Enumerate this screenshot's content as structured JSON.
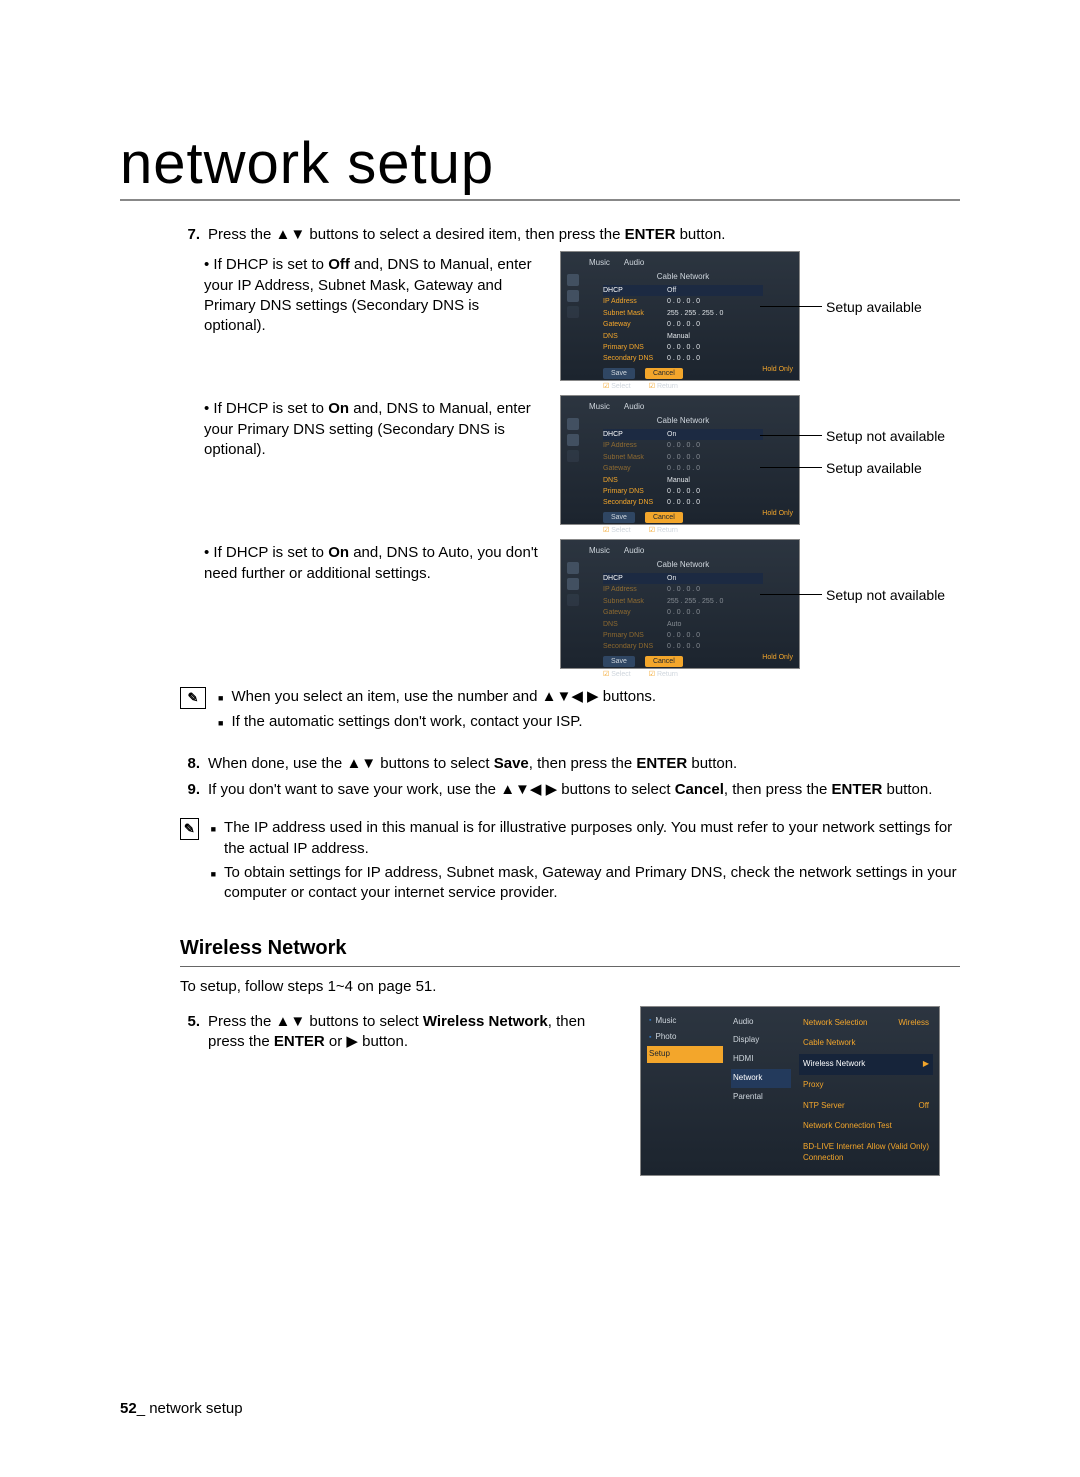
{
  "title": "network setup",
  "step7": {
    "num": "7.",
    "text_a": "Press the ",
    "text_b": " buttons to select a desired item, then press the ",
    "enter": "ENTER",
    "text_c": " button."
  },
  "bullet1": {
    "pre": "If DHCP is set to ",
    "off": "Off",
    "mid": " and, DNS to Manual, enter your IP Address, Subnet Mask, Gateway and Primary DNS settings (Secondary DNS is optional)."
  },
  "bullet2": {
    "pre": "If DHCP is set to ",
    "on": "On",
    "mid": " and, DNS to Manual, enter your Primary DNS setting (Secondary DNS is optional)."
  },
  "bullet3": {
    "pre": "If DHCP is set to ",
    "on": "On",
    "mid": " and, DNS to Auto, you don't need further or additional settings."
  },
  "callouts": {
    "setup_available": "Setup available",
    "setup_not_available": "Setup not available"
  },
  "fig": {
    "tab1": "Music",
    "tab2": "Audio",
    "title": "Cable Network",
    "dhcp": "DHCP",
    "off": "Off",
    "on": "On",
    "auto": "Auto",
    "manual": "Manual",
    "ip": "IP Address",
    "subnet": "Subnet Mask",
    "gateway": "Gateway",
    "dns": "DNS",
    "pdns": "Primary DNS",
    "sdns": "Secondary DNS",
    "v0": "0 . 0 . 0 . 0",
    "v255": "255 . 255 . 255 . 0",
    "save": "Save",
    "cancel": "Cancel",
    "select": "Select",
    "return": "Return",
    "hold": "Hold Only"
  },
  "note1": {
    "a_pre": "When you select an item, use the number and ",
    "a_post": " buttons.",
    "b": "If the automatic settings don't work, contact your ISP."
  },
  "step8": {
    "num": "8.",
    "a": "When done, use the ",
    "b": " buttons to select ",
    "save": "Save",
    "c": ", then press the ",
    "enter": "ENTER",
    "d": " button."
  },
  "step9": {
    "num": "9.",
    "a": "If you don't want to save your work, use the ",
    "b": " buttons to select ",
    "cancel": "Cancel",
    "c": ", then press the ",
    "enter": "ENTER",
    "d": " button."
  },
  "note2": {
    "a": "The IP address used in this manual is for illustrative purposes only. You must refer to your network settings for the actual IP address.",
    "b": "To obtain settings for IP address, Subnet mask, Gateway and Primary DNS, check the network settings in your computer or contact your internet service provider."
  },
  "section": "Wireless Network",
  "wintro": "To setup, follow steps 1~4 on page 51.",
  "step5": {
    "num": "5.",
    "a": "Press the ",
    "b": " buttons to select ",
    "wn": "Wireless Network",
    "c": ", then press the ",
    "enter": "ENTER",
    "d": " or ",
    "e": " button."
  },
  "wshot": {
    "side": {
      "music": "Music",
      "photo": "Photo",
      "setup": "Setup"
    },
    "mid": {
      "audio": "Audio",
      "display": "Display",
      "hdmi": "HDMI",
      "network": "Network",
      "parental": "Parental"
    },
    "right": {
      "nsl": "Network Selection",
      "nsv": "Wireless",
      "cn": "Cable Network",
      "wn": "Wireless Network",
      "wnv": "▶",
      "proxy": "Proxy",
      "ntp": "NTP Server",
      "ntpv": "Off",
      "nct": "Network Connection Test",
      "bd": "BD-LIVE Internet Connection",
      "bdv": "Allow (Valid Only)"
    }
  },
  "footer": {
    "num": "52",
    "sep": "_",
    "label": " network setup"
  },
  "arrows": {
    "ud": "▲▼",
    "all": "▲▼◀ ▶",
    "r": "▶"
  }
}
